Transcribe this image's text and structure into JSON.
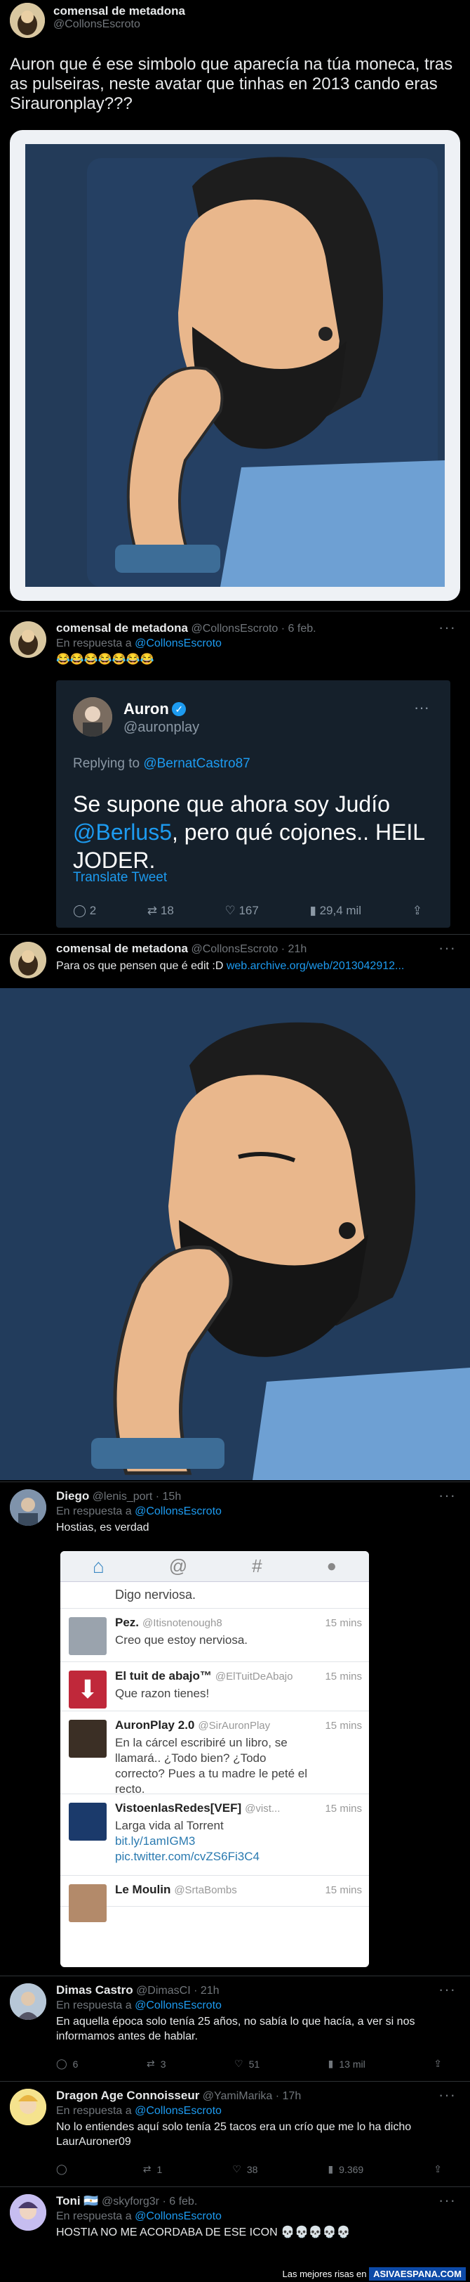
{
  "main": {
    "author": "comensal de metadona",
    "handle": "@CollonsEscroto",
    "text": "Auron que é ese simbolo que aparecía na túa moneca, tras as pulseiras, neste avatar que tinhas en 2013 cando eras Sirauronplay???"
  },
  "reply1": {
    "author": "comensal de metadona",
    "meta": "@CollonsEscroto · 6 feb.",
    "reply_to_prefix": "En respuesta a",
    "reply_to": "@CollonsEscroto",
    "text": "😂😂😂😂😂😂😂",
    "quote": {
      "author": "Auron",
      "handle": "@auronplay",
      "replying_prefix": "Replying to",
      "replying_to": "@BernatCastro87",
      "text_before": "Se supone que ahora soy Judío",
      "mention": "@Berlus5",
      "text_after": ", pero qué cojones.. HEIL JODER.",
      "translate": "Translate Tweet",
      "replies": "2",
      "retweets": "18",
      "likes": "167",
      "views": "29,4 mil"
    }
  },
  "reply2": {
    "author": "comensal de metadona",
    "meta": "@CollonsEscroto · 21h",
    "text": "Para os que pensen que é edit :D",
    "link": "web.archive.org/web/2013042912..."
  },
  "reply3": {
    "author": "Diego",
    "meta": "@lenis_port · 15h",
    "reply_to_prefix": "En respuesta a",
    "reply_to": "@CollonsEscroto",
    "text": "Hostias, es verdad",
    "embed": {
      "partial_top": "Digo nerviosa.",
      "items": [
        {
          "name": "Pez.",
          "handle": "@Itisnotenough8",
          "time": "15 mins",
          "text": "Creo que estoy nerviosa."
        },
        {
          "name": "El tuit de abajo™",
          "handle": "@ElTuitDeAbajo",
          "time": "15 mins",
          "text": "Que razon tienes!"
        },
        {
          "name": "AuronPlay 2.0",
          "handle": "@SirAuronPlay",
          "time": "15 mins",
          "text": "En la cárcel escribiré un libro, se llamará.. ¿Todo bien? ¿Todo correcto? Pues a tu madre le peté el recto."
        },
        {
          "name": "VistoenlasRedes[VEF]",
          "handle": "@vist...",
          "time": "15 mins",
          "text": "Larga vida al Torrent",
          "link1": "bit.ly/1amIGM3",
          "link2": "pic.twitter.com/cvZS6Fi3C4"
        },
        {
          "name": "Le Moulin",
          "handle": "@SrtaBombs",
          "time": "15 mins",
          "text": ""
        }
      ]
    }
  },
  "reply4": {
    "author": "Dimas Castro",
    "meta": "@DimasCI · 21h",
    "reply_to_prefix": "En respuesta a",
    "reply_to": "@CollonsEscroto",
    "text": "En aquella época solo tenía 25 años, no sabía lo que hacía, a ver si nos informamos antes de hablar.",
    "replies": "6",
    "retweets": "3",
    "likes": "51",
    "views": "13 mil"
  },
  "reply5": {
    "author": "Dragon Age Connoisseur",
    "meta": "@YamiMarika · 17h",
    "reply_to_prefix": "En respuesta a",
    "reply_to": "@CollonsEscroto",
    "text": "No lo entiendes aquí solo tenía 25 tacos era un crío que me lo ha dicho LaurAuroner09",
    "replies": "",
    "retweets": "1",
    "likes": "38",
    "views": "9.369"
  },
  "reply6": {
    "author": "Toni 🇦🇷",
    "meta": "@skyforg3r · 6 feb.",
    "reply_to_prefix": "En respuesta a",
    "reply_to": "@CollonsEscroto",
    "text": "HOSTIA NO ME ACORDABA DE ESE ICON 💀💀💀💀💀"
  },
  "footer": {
    "text": "Las mejores risas en",
    "brand": "ASIVAESPANA.COM"
  },
  "colors": {
    "background": "#000000",
    "accent": "#1d9bf0",
    "muted": "#71767b",
    "text": "#e7e9ea"
  }
}
